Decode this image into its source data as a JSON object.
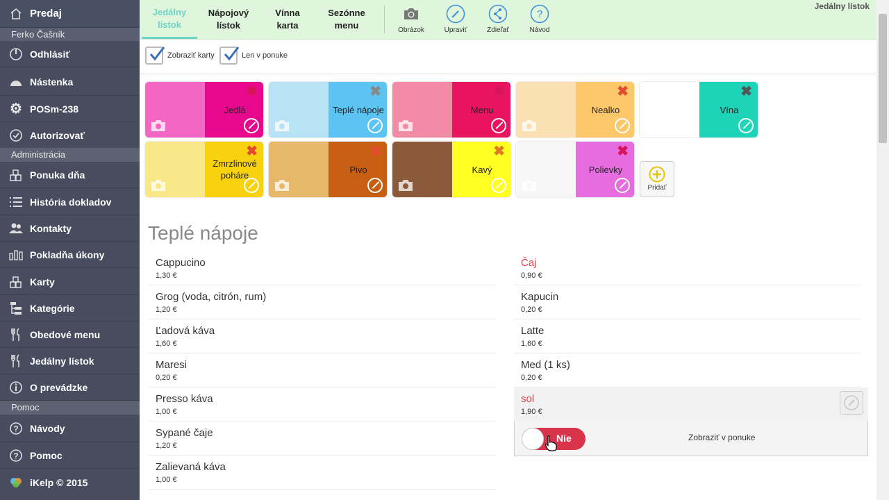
{
  "sidebar": {
    "home": "Predaj",
    "user": "Ferko Čašník",
    "logout": "Odhlásiť",
    "nastenka": "Nástenka",
    "pos": "POSm-238",
    "authorize": "Autorizovať",
    "admin_section": "Administrácia",
    "ponuka": "Ponuka dňa",
    "historia": "História dokladov",
    "kontakty": "Kontakty",
    "pokladna": "Pokladňa úkony",
    "karty": "Karty",
    "kategorie": "Kategórie",
    "obedove": "Obedové menu",
    "jedalny": "Jedálny lístok",
    "prevadzka": "O prevádzke",
    "help_section": "Pomoc",
    "navody": "Návody",
    "pomoc": "Pomoc",
    "brand": "iKelp © 2015"
  },
  "topbar": {
    "tabs": [
      "Jedálny lístok",
      "Nápojový lístok",
      "Vínna karta",
      "Sezónne menu"
    ],
    "tools": [
      "Obrázok",
      "Upraviť",
      "Zdieľať",
      "Návod"
    ],
    "page_label": "Jedálny lístok"
  },
  "filters": {
    "show_cards": "Zobraziť karty",
    "only_menu": "Len v ponuke"
  },
  "tiles": [
    {
      "label": "Jedlá",
      "left": "#f466c4",
      "right": "#e8088e",
      "x": "#d81459"
    },
    {
      "label": "Teplé nápoje",
      "left": "#b8e3f6",
      "right": "#5bc4f2",
      "x": "#888888"
    },
    {
      "label": "Menu",
      "left": "#f38aa6",
      "right": "#e8145e",
      "x": "#d81459"
    },
    {
      "label": "Nealko",
      "left": "#fbe0b3",
      "right": "#fcc86a",
      "x": "#e24a32"
    },
    {
      "label": "Vína",
      "left": "#ffffff",
      "right": "#1dd3b8",
      "x": "#555555"
    },
    {
      "label": "Zmrzlinové poháre",
      "left": "#f9e788",
      "right": "#f8d20e",
      "x": "#e24a32"
    },
    {
      "label": "Pivo",
      "left": "#e8b86a",
      "right": "#c75f12",
      "x": "#e24a32"
    },
    {
      "label": "Kavý",
      "left": "#8a5a3a",
      "right": "#ffff22",
      "x": "#e27a22"
    },
    {
      "label": "Polievky",
      "left": "#f7f7f7",
      "right": "#e66ce0",
      "x": "#d81459"
    }
  ],
  "add_label": "Pridať",
  "category_title": "Teplé nápoje",
  "items_left": [
    {
      "name": "Cappucino",
      "price": "1,30 €"
    },
    {
      "name": "Grog (voda, citrón, rum)",
      "price": "1,20 €"
    },
    {
      "name": "Ľadová káva",
      "price": "1,60 €"
    },
    {
      "name": "Maresi",
      "price": "0,20 €"
    },
    {
      "name": "Presso káva",
      "price": "1,00 €"
    },
    {
      "name": "Sypané čaje",
      "price": "1,20 €"
    },
    {
      "name": "Zalievaná káva",
      "price": "1,00 €"
    }
  ],
  "items_right": [
    {
      "name": "Čaj",
      "price": "0,90 €"
    },
    {
      "name": "Kapucin",
      "price": "0,20 €"
    },
    {
      "name": "Latte",
      "price": "1,60 €"
    },
    {
      "name": "Med (1 ks)",
      "price": "0,20 €"
    },
    {
      "name": "sol",
      "price": "1,90 €"
    }
  ],
  "toggle": {
    "state": "Nie",
    "label": "Zobraziť v ponuke"
  }
}
